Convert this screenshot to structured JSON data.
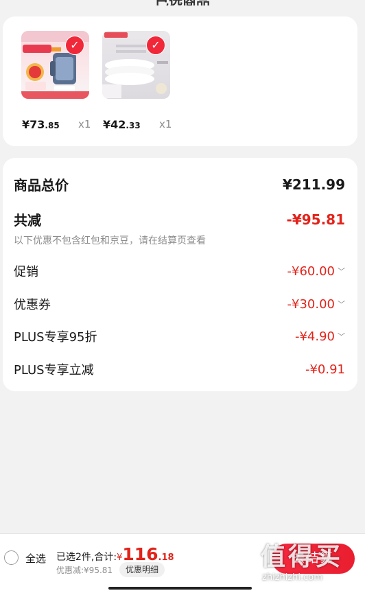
{
  "header": {
    "title_cut": "已选商品"
  },
  "products": [
    {
      "price_int": "¥73",
      "price_dec": ".85",
      "qty": "x1"
    },
    {
      "price_int": "¥42",
      "price_dec": ".33",
      "qty": "x1"
    }
  ],
  "summary": {
    "total_label": "商品总价",
    "total_value": "¥211.99",
    "reduce_label": "共减",
    "reduce_value": "-¥95.81",
    "note": "以下优惠不包含红包和京豆，请在结算页查看",
    "items": [
      {
        "label": "促销",
        "value": "-¥60.00",
        "expandable": true
      },
      {
        "label": "优惠券",
        "value": "-¥30.00",
        "expandable": true
      },
      {
        "label": "PLUS专享95折",
        "value": "-¥4.90",
        "expandable": true
      },
      {
        "label": "PLUS专享立减",
        "value": "-¥0.91",
        "expandable": false
      }
    ]
  },
  "bottom": {
    "select_all": "全选",
    "summary_prefix": "已选2件,合计:",
    "currency": "¥",
    "total_int": "116",
    "total_dec": ".18",
    "discount_text": "优惠减:¥95.81",
    "detail_button": "优惠明细",
    "checkout_button": "去结算"
  },
  "watermark": {
    "text": "值得买",
    "url": "zhizhizhi.com"
  },
  "colors": {
    "accent": "#e2231a",
    "brand_red": "#f0283a"
  }
}
